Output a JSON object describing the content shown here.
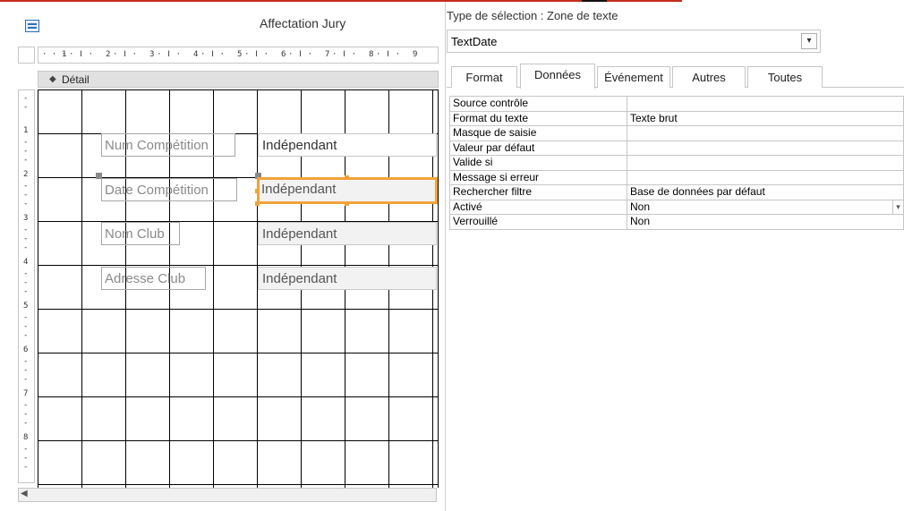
{
  "form": {
    "title": "Affectation Jury",
    "ruler_marks": [
      "1",
      "2",
      "3",
      "4",
      "5",
      "6",
      "7",
      "8",
      "9"
    ],
    "vruler_marks": [
      "1",
      "2",
      "3",
      "4",
      "5",
      "6",
      "7",
      "8"
    ],
    "section_label": "Détail",
    "controls": [
      {
        "label": "Num Compétition",
        "field": "Indépendant"
      },
      {
        "label": "Date Compétition",
        "field": "Indépendant"
      },
      {
        "label": "Nom Club",
        "field": "Indépendant"
      },
      {
        "label": "Adresse Club",
        "field": "Indépendant"
      }
    ]
  },
  "property_sheet": {
    "selection_type": "Type de sélection :  Zone de texte",
    "object_name": "TextDate",
    "tabs": [
      {
        "label": "Format",
        "active": false
      },
      {
        "label": "Données",
        "active": true
      },
      {
        "label": "Événement",
        "active": false
      },
      {
        "label": "Autres",
        "active": false
      },
      {
        "label": "Toutes",
        "active": false
      }
    ],
    "properties": [
      {
        "name": "Source contrôle",
        "value": ""
      },
      {
        "name": "Format du texte",
        "value": "Texte brut"
      },
      {
        "name": "Masque de saisie",
        "value": ""
      },
      {
        "name": "Valeur par défaut",
        "value": ""
      },
      {
        "name": "Valide si",
        "value": ""
      },
      {
        "name": "Message si erreur",
        "value": ""
      },
      {
        "name": "Rechercher filtre",
        "value": "Base de données par défaut"
      },
      {
        "name": "Activé",
        "value": "Non"
      },
      {
        "name": "Verrouillé",
        "value": "Non"
      }
    ]
  },
  "colors": {
    "selection_accent": "#f0a33b",
    "grid_line": "#000000"
  }
}
